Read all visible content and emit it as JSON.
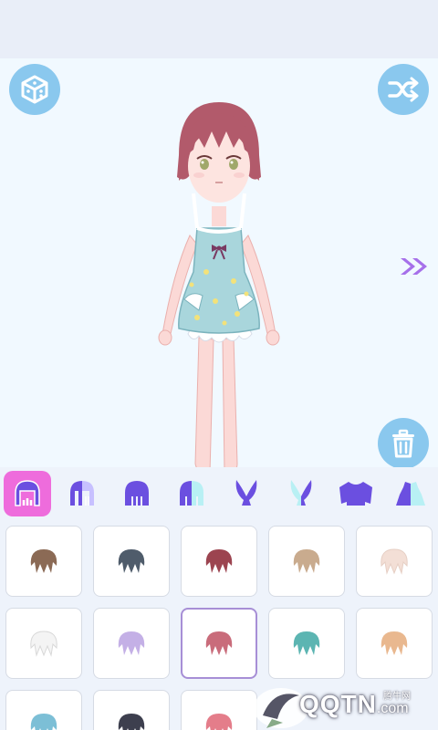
{
  "colors": {
    "accent": "#8ac8ee",
    "active_tab": "#ee6cdc",
    "icon_purple": "#6b4fe0",
    "arrow_purple": "#a670ea",
    "selected_border": "#a78fd6"
  },
  "toolbar": {
    "left_icon": "cube-icon",
    "right_icon": "shuffle-icon",
    "next_icon": "double-chevron-right-icon",
    "delete_icon": "trash-icon"
  },
  "category_tabs": [
    {
      "icon": "hair-front-icon",
      "active": true
    },
    {
      "icon": "hair-front-two-tone-icon",
      "active": false
    },
    {
      "icon": "hair-back-icon",
      "active": false
    },
    {
      "icon": "hair-back-two-tone-icon",
      "active": false
    },
    {
      "icon": "bunny-ears-icon",
      "active": false
    },
    {
      "icon": "bunny-ears-two-tone-icon",
      "active": false
    },
    {
      "icon": "top-shirt-icon",
      "active": false
    },
    {
      "icon": "dress-icon",
      "active": false
    }
  ],
  "hair_options": [
    {
      "color": "#8b6a55",
      "selected": false
    },
    {
      "color": "#4f5c6b",
      "selected": false
    },
    {
      "color": "#9c4450",
      "selected": false
    },
    {
      "color": "#c9ab8e",
      "selected": false
    },
    {
      "color": "#f3dfd6",
      "selected": false
    },
    {
      "color": "#f4f4f4",
      "selected": false
    },
    {
      "color": "#c4b0e6",
      "selected": false
    },
    {
      "color": "#c96c7b",
      "selected": true
    },
    {
      "color": "#5cb5b2",
      "selected": false
    },
    {
      "color": "#e9b88f",
      "selected": false
    },
    {
      "color": "#7cbfd6",
      "selected": false
    },
    {
      "color": "#3d3f4e",
      "selected": false
    },
    {
      "color": "#e47d8a",
      "selected": false
    }
  ],
  "watermark": {
    "brand": "QQTN",
    "suffix": ".com",
    "small": "腾牛网"
  }
}
